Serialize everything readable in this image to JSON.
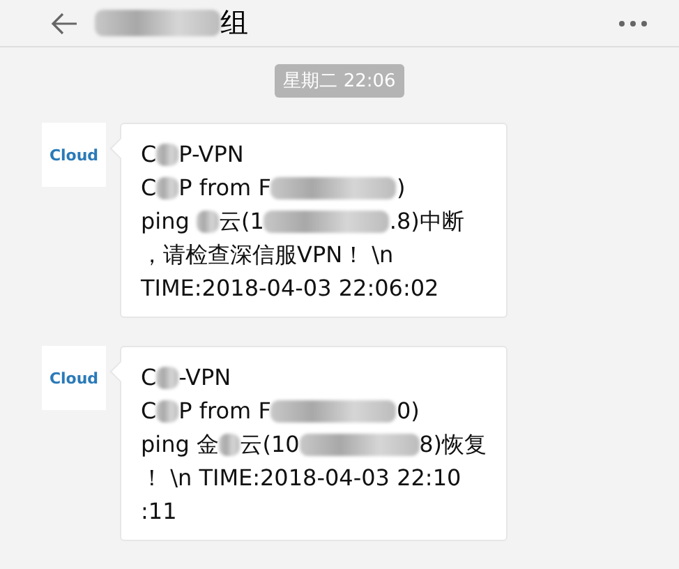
{
  "header": {
    "title": [
      {
        "kind": "blur_long"
      },
      {
        "kind": "text",
        "text": "组"
      }
    ]
  },
  "time_divider": "星期二 22:06",
  "messages": [
    {
      "avatar": "Cloud",
      "lines": [
        [
          {
            "kind": "text",
            "text": "C"
          },
          {
            "kind": "blur_short"
          },
          {
            "kind": "text",
            "text": "P-VPN"
          }
        ],
        [
          {
            "kind": "text",
            "text": "C"
          },
          {
            "kind": "blur_short"
          },
          {
            "kind": "text",
            "text": "P from F"
          },
          {
            "kind": "blur_long"
          },
          {
            "kind": "text",
            "text": ")"
          }
        ],
        [
          {
            "kind": "text",
            "text": "ping "
          },
          {
            "kind": "blur_short"
          },
          {
            "kind": "text",
            "text": "云(1"
          },
          {
            "kind": "blur_long"
          },
          {
            "kind": "text",
            "text": ".8)中断"
          }
        ],
        [
          {
            "kind": "text",
            "text": "，请检查深信服VPN！ \\n"
          }
        ],
        [
          {
            "kind": "text",
            "text": "TIME:2018-04-03 22:06:02"
          }
        ]
      ]
    },
    {
      "avatar": "Cloud",
      "lines": [
        [
          {
            "kind": "text",
            "text": "C"
          },
          {
            "kind": "blur_short"
          },
          {
            "kind": "text",
            "text": "-VPN"
          }
        ],
        [
          {
            "kind": "text",
            "text": "C"
          },
          {
            "kind": "blur_short"
          },
          {
            "kind": "text",
            "text": "P from F"
          },
          {
            "kind": "blur_long"
          },
          {
            "kind": "text",
            "text": "0)"
          }
        ],
        [
          {
            "kind": "text",
            "text": "ping 金"
          },
          {
            "kind": "blur_short"
          },
          {
            "kind": "text",
            "text": "云(10"
          },
          {
            "kind": "blur_long"
          },
          {
            "kind": "text",
            "text": "8)恢复"
          }
        ],
        [
          {
            "kind": "text",
            "text": "！ \\n TIME:2018-04-03 22:10"
          }
        ],
        [
          {
            "kind": "text",
            "text": ":11"
          }
        ]
      ]
    }
  ]
}
